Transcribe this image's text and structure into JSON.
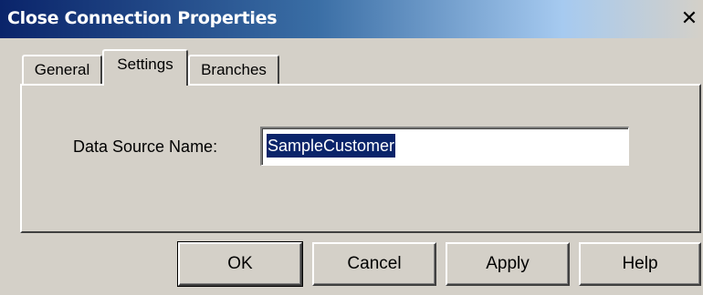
{
  "window": {
    "title": "Close Connection Properties",
    "close_glyph": "✕",
    "close_icon": "close-icon"
  },
  "tabs": [
    {
      "label": "General",
      "active": false
    },
    {
      "label": "Settings",
      "active": true
    },
    {
      "label": "Branches",
      "active": false
    }
  ],
  "settings": {
    "data_source_label": "Data Source Name:",
    "data_source_value": "SampleCustomer"
  },
  "buttons": {
    "ok": "OK",
    "cancel": "Cancel",
    "apply": "Apply",
    "help": "Help"
  },
  "colors": {
    "title_gradient_start": "#0a246a",
    "selection": "#0a246a",
    "face": "#d4d0c8"
  }
}
